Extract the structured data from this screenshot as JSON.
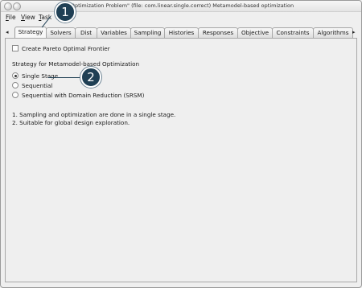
{
  "window": {
    "title": "\"Optimization Problem\" (file: com.linear.single.correct)   Metamodel-based optimization"
  },
  "menu": {
    "items": [
      "File",
      "View",
      "Task"
    ],
    "underline_first": [
      "F",
      "V",
      "T"
    ],
    "rest": [
      "ile",
      "iew",
      "ask"
    ]
  },
  "tabs": {
    "left_arrow": "◂",
    "right_arrow": "▸",
    "items": [
      "Strategy",
      "Solvers",
      "Dist",
      "Variables",
      "Sampling",
      "Histories",
      "Responses",
      "Objective",
      "Constraints",
      "Algorithms"
    ],
    "active": "Strategy"
  },
  "strategy": {
    "pareto_label": "Create Pareto Optimal Frontier",
    "pareto_checked": false,
    "section_label": "Strategy for Metamodel-based Optimization",
    "options": [
      "Single Stage",
      "Sequential",
      "Sequential with Domain Reduction (SRSM)"
    ],
    "selected": "Single Stage",
    "notes": [
      "1. Sampling and optimization are done in a single stage.",
      "2. Suitable for global design exploration."
    ]
  },
  "callouts": [
    "1",
    "2"
  ],
  "colors": {
    "callout_fill": "#1f3f54",
    "window_bg": "#efefef"
  }
}
